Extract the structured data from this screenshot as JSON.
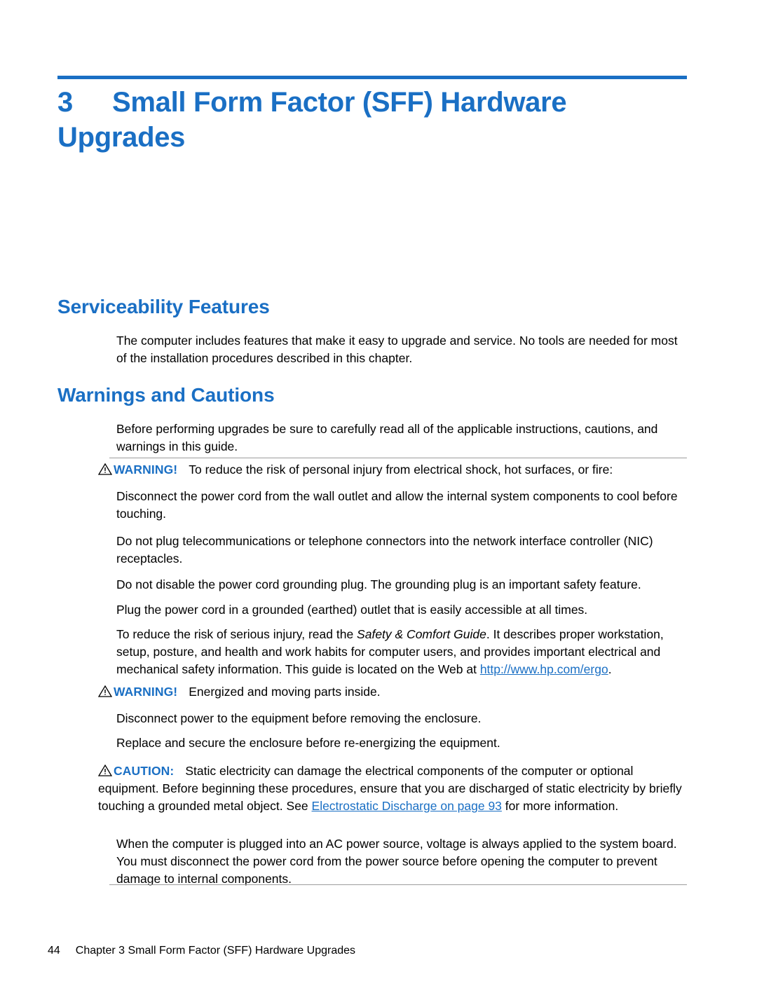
{
  "chapter": {
    "number": "3",
    "title": "Small Form Factor (SFF) Hardware Upgrades"
  },
  "sections": {
    "serviceability": {
      "heading": "Serviceability Features",
      "body": "The computer includes features that make it easy to upgrade and service. No tools are needed for most of the installation procedures described in this chapter."
    },
    "warnings": {
      "heading": "Warnings and Cautions",
      "intro": "Before performing upgrades be sure to carefully read all of the applicable instructions, cautions, and warnings in this guide.",
      "warning1": {
        "label": "WARNING!",
        "text": "To reduce the risk of personal injury from electrical shock, hot surfaces, or fire:",
        "p1": "Disconnect the power cord from the wall outlet and allow the internal system components to cool before touching.",
        "p2": "Do not plug telecommunications or telephone connectors into the network interface controller (NIC) receptacles.",
        "p3": "Do not disable the power cord grounding plug. The grounding plug is an important safety feature.",
        "p4": "Plug the power cord in a grounded (earthed) outlet that is easily accessible at all times.",
        "p5_a": "To reduce the risk of serious injury, read the ",
        "p5_italic": "Safety & Comfort Guide",
        "p5_b": ". It describes proper workstation, setup, posture, and health and work habits for computer users, and provides important electrical and mechanical safety information. This guide is located on the Web at ",
        "p5_link": "http://www.hp.com/ergo",
        "p5_c": "."
      },
      "warning2": {
        "label": "WARNING!",
        "text": "Energized and moving parts inside.",
        "p1": "Disconnect power to the equipment before removing the enclosure.",
        "p2": "Replace and secure the enclosure before re-energizing the equipment."
      },
      "caution": {
        "label": "CAUTION:",
        "text_a": "Static electricity can damage the electrical components of the computer or optional equipment. Before beginning these procedures, ensure that you are discharged of static electricity by briefly touching a grounded metal object. See ",
        "link": "Electrostatic Discharge on page 93",
        "text_b": " for more information.",
        "p2": "When the computer is plugged into an AC power source, voltage is always applied to the system board. You must disconnect the power cord from the power source before opening the computer to prevent damage to internal components."
      }
    }
  },
  "footer": {
    "page_number": "44",
    "text": "Chapter 3   Small Form Factor (SFF) Hardware Upgrades"
  },
  "colors": {
    "accent": "#1a6fc4",
    "rule": "#9c9c9c"
  }
}
